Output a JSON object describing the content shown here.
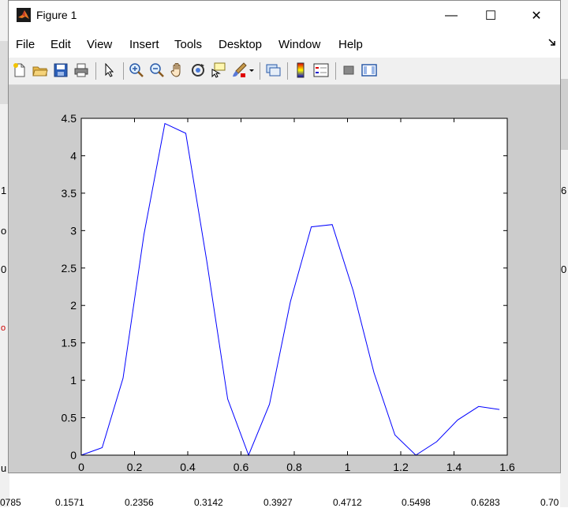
{
  "window": {
    "title": "Figure 1",
    "controls": {
      "minimize": "—",
      "maximize": "☐",
      "close": "✕"
    }
  },
  "menu": {
    "items": [
      {
        "label": "File"
      },
      {
        "label": "Edit"
      },
      {
        "label": "View"
      },
      {
        "label": "Insert"
      },
      {
        "label": "Tools"
      },
      {
        "label": "Desktop"
      },
      {
        "label": "Window"
      },
      {
        "label": "Help"
      }
    ]
  },
  "toolbar": {
    "icons": [
      "new-figure-icon",
      "open-file-icon",
      "save-icon",
      "print-icon",
      "edit-plot-arrow-icon",
      "zoom-in-icon",
      "zoom-out-icon",
      "pan-hand-icon",
      "rotate-3d-icon",
      "data-cursor-icon",
      "brush-icon",
      "brush-dropdown-icon",
      "link-plot-icon",
      "colorbar-icon",
      "legend-icon",
      "hide-plot-tools-icon",
      "show-plot-tools-icon"
    ]
  },
  "background": {
    "left_labels": [
      "1",
      "o",
      "0",
      "o",
      "u"
    ],
    "right_labels": [
      "6",
      "0"
    ],
    "bottom_row": [
      "0785",
      "0.1571",
      "0.2356",
      "0.3142",
      "0.3927",
      "0.4712",
      "0.5498",
      "0.6283",
      "0.70"
    ]
  },
  "chart_data": {
    "type": "line",
    "xlim": [
      0,
      1.6
    ],
    "ylim": [
      0,
      4.5
    ],
    "x_ticks": [
      "0",
      "0.2",
      "0.4",
      "0.6",
      "0.8",
      "1",
      "1.2",
      "1.4",
      "1.6"
    ],
    "y_ticks": [
      "0",
      "0.5",
      "1",
      "1.5",
      "2",
      "2.5",
      "3",
      "3.5",
      "4",
      "4.5"
    ],
    "grid": false,
    "line_color": "#0000ff",
    "series": [
      {
        "x": [
          0,
          0.0785,
          0.1571,
          0.2356,
          0.3142,
          0.3927,
          0.4712,
          0.5498,
          0.6283,
          0.7069,
          0.7854,
          0.8639,
          0.9425,
          1.021,
          1.0996,
          1.1781,
          1.2566,
          1.3352,
          1.4137,
          1.4923,
          1.5708
        ],
        "y": [
          0,
          0.1,
          1.03,
          2.95,
          4.43,
          4.3,
          2.6,
          0.75,
          0,
          0.68,
          2.05,
          3.05,
          3.08,
          2.2,
          1.1,
          0.27,
          0,
          0.18,
          0.47,
          0.65,
          0.61
        ]
      }
    ]
  }
}
